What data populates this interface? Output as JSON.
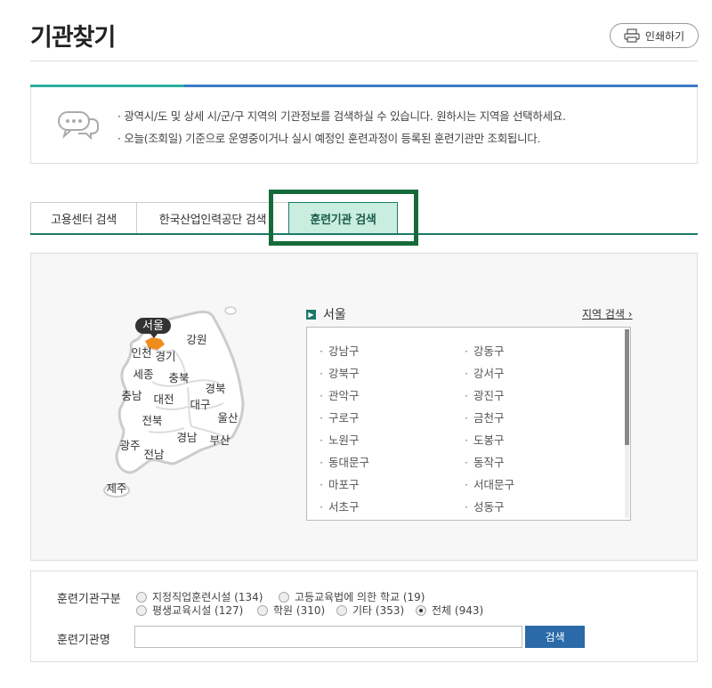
{
  "header": {
    "title": "기관찾기",
    "print_label": "인쇄하기"
  },
  "info": {
    "lines": [
      "· 광역시/도 및 상세 시/군/구 지역의 기관정보를 검색하실 수 있습니다. 원하시는 지역을 선택하세요.",
      "· 오늘(조회일) 기준으로 운영중이거나 실시 예정인 훈련과정이 등록된 훈련기관만 조회됩니다."
    ]
  },
  "tabs": [
    {
      "label": "고용센터 검색"
    },
    {
      "label": "한국산업인력공단 검색"
    },
    {
      "label": "훈련기관 검색",
      "active": true
    }
  ],
  "map": {
    "selected_badge": "서울",
    "regions": {
      "incheon": "인천",
      "gyeonggi": "경기",
      "gangwon": "강원",
      "sejong": "세종",
      "chungbuk": "충북",
      "chungnam": "충남",
      "daejeon": "대전",
      "gyeongbuk": "경북",
      "daegu": "대구",
      "ulsan": "울산",
      "jeonbuk": "전북",
      "gyeongnam": "경남",
      "busan": "부산",
      "gwangju": "광주",
      "jeonnam": "전남",
      "jeju": "제주"
    }
  },
  "region_panel": {
    "heading": "서울",
    "link": "지역 검색 ›",
    "left": [
      "강남구",
      "강북구",
      "관악구",
      "구로구",
      "노원구",
      "동대문구",
      "마포구",
      "서초구"
    ],
    "right": [
      "강동구",
      "강서구",
      "광진구",
      "금천구",
      "도봉구",
      "동작구",
      "서대문구",
      "성동구"
    ]
  },
  "filter": {
    "type_label": "훈련기관구분",
    "options": [
      {
        "label": "지정직업훈련시설 (134)",
        "checked": false
      },
      {
        "label": "고등교육법에 의한 학교 (19)",
        "checked": false
      },
      {
        "label": "평생교육시설 (127)",
        "checked": false
      },
      {
        "label": "학원 (310)",
        "checked": false
      },
      {
        "label": "기타 (353)",
        "checked": false
      },
      {
        "label": "전체 (943)",
        "checked": true
      }
    ],
    "name_label": "훈련기관명",
    "name_value": "",
    "search_label": "검색"
  },
  "colors": {
    "accent_teal": "#2bb0a0",
    "accent_blue": "#3b7bc8",
    "tab_active_bg": "#c9eee0",
    "highlight_frame": "#166a3a",
    "seoul": "#f08c1e",
    "search_button": "#2a6aa8"
  }
}
